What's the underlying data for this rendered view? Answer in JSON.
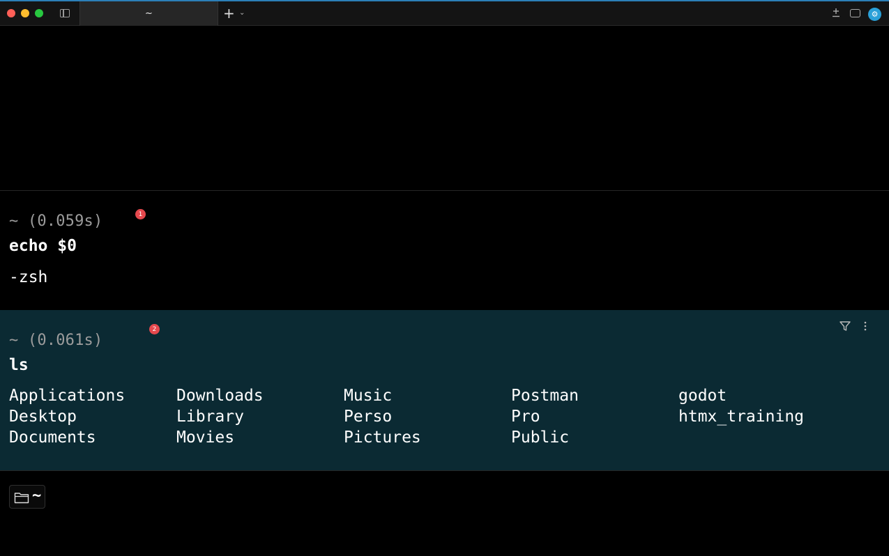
{
  "window": {
    "tab_title": "~",
    "new_tab_label": "+",
    "new_tab_menu": "⌄",
    "avatar_glyph": "⚙"
  },
  "blocks": [
    {
      "prompt": "~ (0.059s)",
      "badge": "1",
      "command": "echo $0",
      "output": "-zsh"
    },
    {
      "prompt": "~ (0.061s)",
      "badge": "2",
      "command": "ls",
      "output_columns": [
        [
          "Applications",
          "Desktop",
          "Documents"
        ],
        [
          "Downloads",
          "Library",
          "Movies"
        ],
        [
          "Music",
          "Perso",
          "Pictures"
        ],
        [
          "Postman",
          "Pro",
          "Public"
        ],
        [
          "godot",
          "htmx_training"
        ]
      ]
    }
  ],
  "input": {
    "directory": "~"
  },
  "colors": {
    "active_block_bg": "#0b2a33",
    "badge": "#e5484d",
    "accent": "#2aa0d8"
  },
  "icons": [
    "sidebar-toggle-icon",
    "new-tab-icon",
    "warp-drive-icon",
    "inbox-icon",
    "settings-icon",
    "filter-icon",
    "more-options-icon",
    "folder-icon"
  ]
}
